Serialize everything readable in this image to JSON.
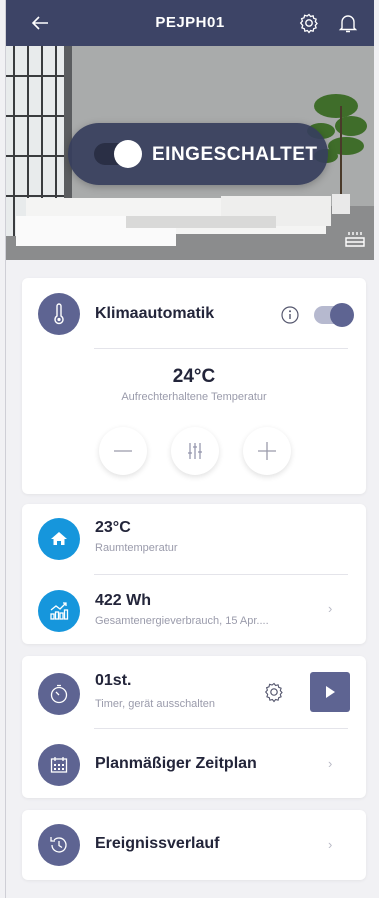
{
  "header": {
    "title": "PEJPH01"
  },
  "hero": {
    "power_label": "EINGESCHALTET",
    "power_on": true
  },
  "climate": {
    "title": "Klimaautomatik",
    "enabled": true,
    "temperature": "24°C",
    "temperature_label": "Aufrechterhaltene Temperatur"
  },
  "room": {
    "value": "23°C",
    "label": "Raumtemperatur"
  },
  "energy": {
    "value": "422 Wh",
    "label": "Gesamtenergieverbrauch, 15 Apr...."
  },
  "timer": {
    "value": "01st.",
    "label": "Timer, gerät ausschalten"
  },
  "schedule": {
    "title": "Planmäßiger Zeitplan"
  },
  "history": {
    "title": "Ereignissverlauf"
  },
  "colors": {
    "header": "#3d4466",
    "accent": "#5e6492",
    "info": "#1696dc"
  },
  "icons": [
    "back-arrow-icon",
    "gear-icon",
    "bell-icon",
    "thermometer-icon",
    "info-icon",
    "minus-icon",
    "sliders-icon",
    "plus-icon",
    "home-icon",
    "chart-icon",
    "timer-icon",
    "play-icon",
    "calendar-icon",
    "history-icon",
    "heater-icon"
  ]
}
